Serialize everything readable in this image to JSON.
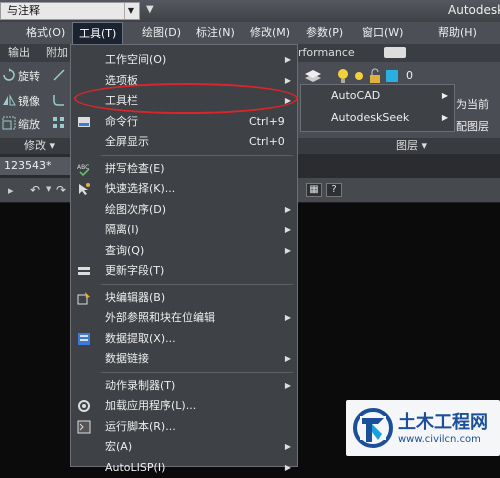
{
  "app": {
    "title": "Autodesk",
    "workspace_combo": "与注释"
  },
  "menubar": [
    {
      "label": "格式(O)"
    },
    {
      "label": "工具(T)",
      "selected": true
    },
    {
      "label": "绘图(D)"
    },
    {
      "label": "标注(N)"
    },
    {
      "label": "修改(M)"
    },
    {
      "label": "参数(P)"
    },
    {
      "label": "窗口(W)"
    },
    {
      "label": "帮助(H)"
    }
  ],
  "ribbon_tabs": [
    "输出",
    "附加",
    "rformance"
  ],
  "ribbon": {
    "buttons": [
      "旋转",
      "镜像",
      "缩放"
    ],
    "panel_modify": "修改",
    "panel_layer": "图层",
    "right_texts": [
      "为当前",
      "配图层"
    ],
    "layer_number": "0"
  },
  "file_tab": "123543*",
  "tools_menu": [
    {
      "label": "工作空间(O)",
      "submenu": true
    },
    {
      "label": "选项板",
      "submenu": true
    },
    {
      "label": "工具栏",
      "submenu": true,
      "highlighted": true
    },
    {
      "label": "命令行",
      "shortcut": "Ctrl+9",
      "icon": "command-line-icon"
    },
    {
      "label": "全屏显示",
      "shortcut": "Ctrl+0"
    },
    {
      "separator": true
    },
    {
      "label": "拼写检查(E)",
      "icon": "spell-check-icon"
    },
    {
      "label": "快速选择(K)...",
      "icon": "quick-select-icon"
    },
    {
      "label": "绘图次序(D)",
      "submenu": true
    },
    {
      "label": "隔离(I)",
      "submenu": true
    },
    {
      "label": "查询(Q)",
      "submenu": true
    },
    {
      "label": "更新字段(T)",
      "icon": "update-field-icon"
    },
    {
      "separator": true
    },
    {
      "label": "块编辑器(B)",
      "icon": "block-editor-icon"
    },
    {
      "label": "外部参照和块在位编辑",
      "submenu": true
    },
    {
      "label": "数据提取(X)...",
      "icon": "data-extraction-icon"
    },
    {
      "label": "数据链接",
      "submenu": true
    },
    {
      "separator": true
    },
    {
      "label": "动作录制器(T)",
      "submenu": true
    },
    {
      "label": "加载应用程序(L)...",
      "icon": "load-app-icon"
    },
    {
      "label": "运行脚本(R)...",
      "icon": "run-script-icon"
    },
    {
      "label": "宏(A)",
      "submenu": true
    },
    {
      "label": "AutoLISP(I)",
      "submenu": true
    }
  ],
  "toolbar_submenu": [
    {
      "label": "AutoCAD"
    },
    {
      "label": "AutodeskSeek"
    }
  ],
  "watermark": {
    "name": "土木工程网",
    "url": "www.civilcn.com"
  },
  "colors": {
    "menu_bg": "#3e4145",
    "highlight": "#d8262b",
    "watermark_blue": "#1b4f9a"
  }
}
